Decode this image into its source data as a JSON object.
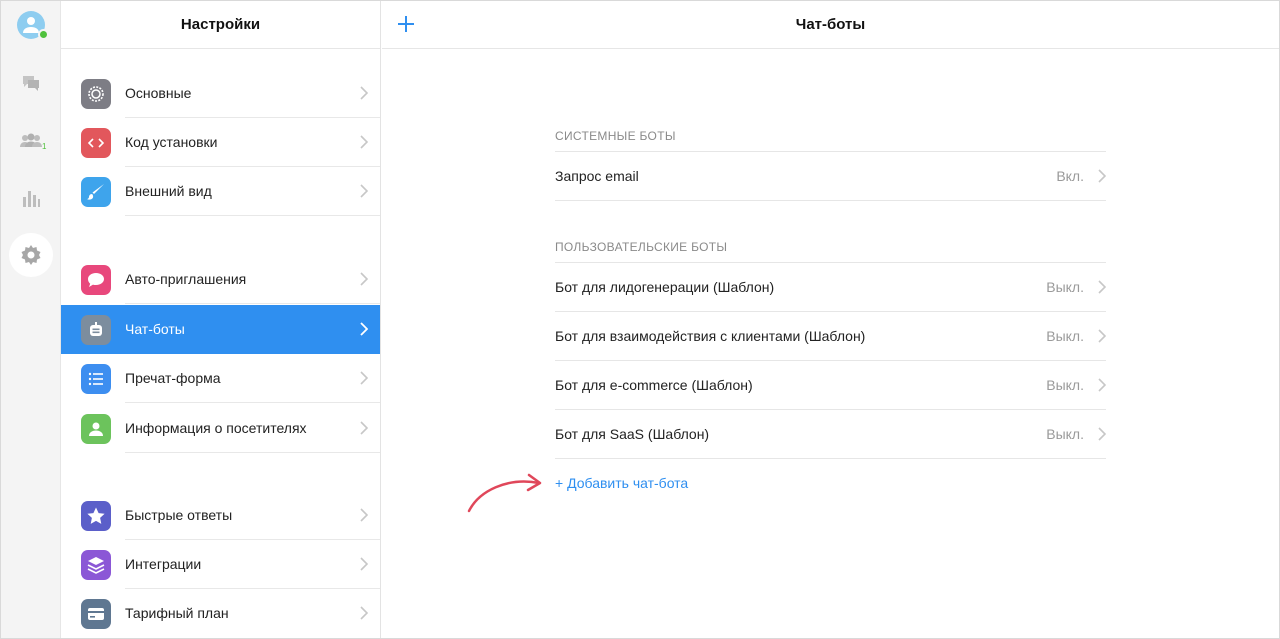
{
  "colors": {
    "accent": "#2f8ff0",
    "online": "#4fc13c",
    "arrow": "#e0475a"
  },
  "rail": {
    "icons": [
      "user-avatar-icon",
      "chat-icon",
      "visitors-icon",
      "stats-icon",
      "gear-icon"
    ],
    "visitors_badge": "1"
  },
  "settings": {
    "title": "Настройки",
    "items": [
      {
        "label": "Основные",
        "icon": "gear-icon",
        "color": "#7d7d85"
      },
      {
        "label": "Код установки",
        "icon": "code-icon",
        "color": "#e2575c"
      },
      {
        "label": "Внешний вид",
        "icon": "brush-icon",
        "color": "#3ea4ec"
      },
      {
        "label": "Авто-приглашения",
        "icon": "speech-bubble-icon",
        "color": "#e8487c"
      },
      {
        "label": "Чат-боты",
        "icon": "bot-icon",
        "color": "#7c8d9e"
      },
      {
        "label": "Пречат-форма",
        "icon": "list-icon",
        "color": "#3d8ef0"
      },
      {
        "label": "Информация о посетителях",
        "icon": "person-icon",
        "color": "#6cc35c"
      },
      {
        "label": "Быстрые ответы",
        "icon": "star-icon",
        "color": "#5b5fc9"
      },
      {
        "label": "Интеграции",
        "icon": "layers-icon",
        "color": "#8b57d6"
      },
      {
        "label": "Тарифный план",
        "icon": "card-icon",
        "color": "#5f7791"
      }
    ],
    "active_index": 4
  },
  "main": {
    "title": "Чат-боты",
    "system_section": "СИСТЕМНЫЕ БОТЫ",
    "system_bots": [
      {
        "name": "Запрос email",
        "status": "Вкл."
      }
    ],
    "user_section": "ПОЛЬЗОВАТЕЛЬСКИЕ БОТЫ",
    "user_bots": [
      {
        "name": "Бот для лидогенерации (Шаблон)",
        "status": "Выкл."
      },
      {
        "name": "Бот для взаимодействия с клиентами (Шаблон)",
        "status": "Выкл."
      },
      {
        "name": "Бот для e-commerce (Шаблон)",
        "status": "Выкл."
      },
      {
        "name": "Бот для SaaS (Шаблон)",
        "status": "Выкл."
      }
    ],
    "add_label": "+ Добавить чат-бота"
  }
}
